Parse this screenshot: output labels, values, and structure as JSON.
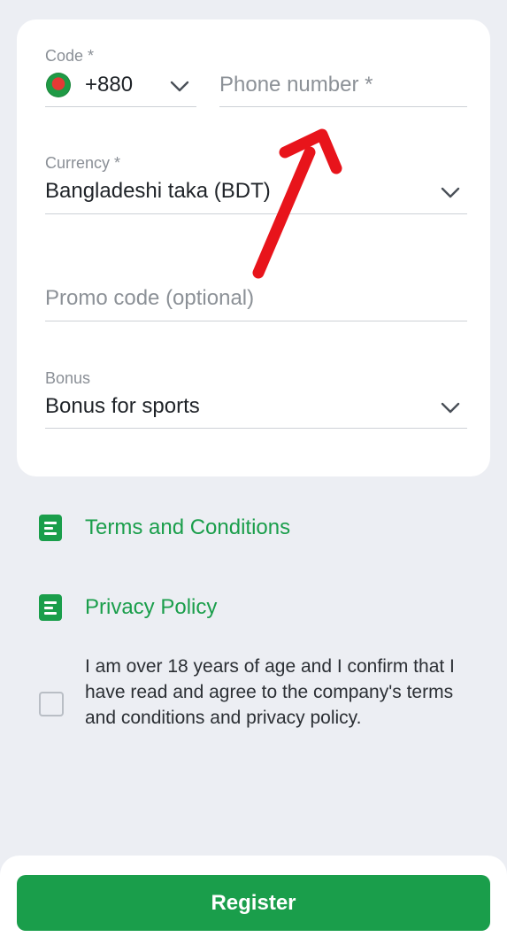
{
  "form": {
    "code": {
      "label": "Code *",
      "value": "+880"
    },
    "phone": {
      "placeholder": "Phone number *"
    },
    "currency": {
      "label": "Currency *",
      "value": "Bangladeshi taka (BDT)"
    },
    "promo": {
      "placeholder": "Promo code (optional)"
    },
    "bonus": {
      "label": "Bonus",
      "value": "Bonus for sports"
    }
  },
  "links": {
    "terms": "Terms and Conditions",
    "privacy": "Privacy Policy"
  },
  "consent": {
    "text": "I am over 18 years of age and I confirm that I have read and agree to the company's terms and conditions and privacy policy.",
    "checked": false
  },
  "actions": {
    "register_label": "Register"
  },
  "colors": {
    "accent": "#1a9e4b",
    "annotation_arrow": "#e8141b",
    "background": "#eceef3"
  },
  "icons": {
    "flag": "bangladesh-flag-icon",
    "dropdown": "chevron-down-icon",
    "document": "document-icon",
    "annotation": "red-arrow"
  }
}
